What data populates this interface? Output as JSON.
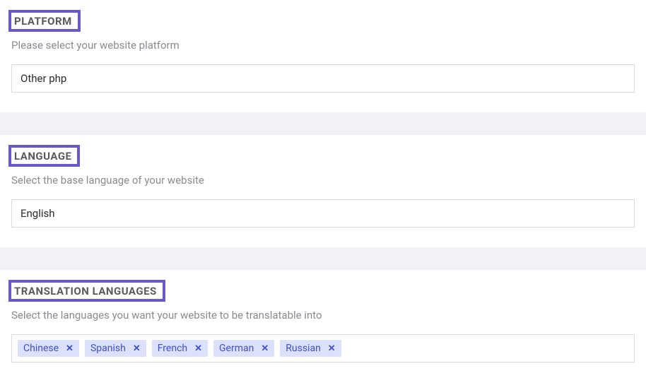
{
  "platform": {
    "title": "PLATFORM",
    "sub": "Please select your website platform",
    "value": "Other php"
  },
  "language": {
    "title": "LANGUAGE",
    "sub": "Select the base language of your website",
    "value": "English"
  },
  "translations": {
    "title": "TRANSLATION LANGUAGES",
    "sub": "Select the languages you want your website to be translatable into",
    "tags": [
      "Chinese",
      "Spanish",
      "French",
      "German",
      "Russian"
    ]
  }
}
